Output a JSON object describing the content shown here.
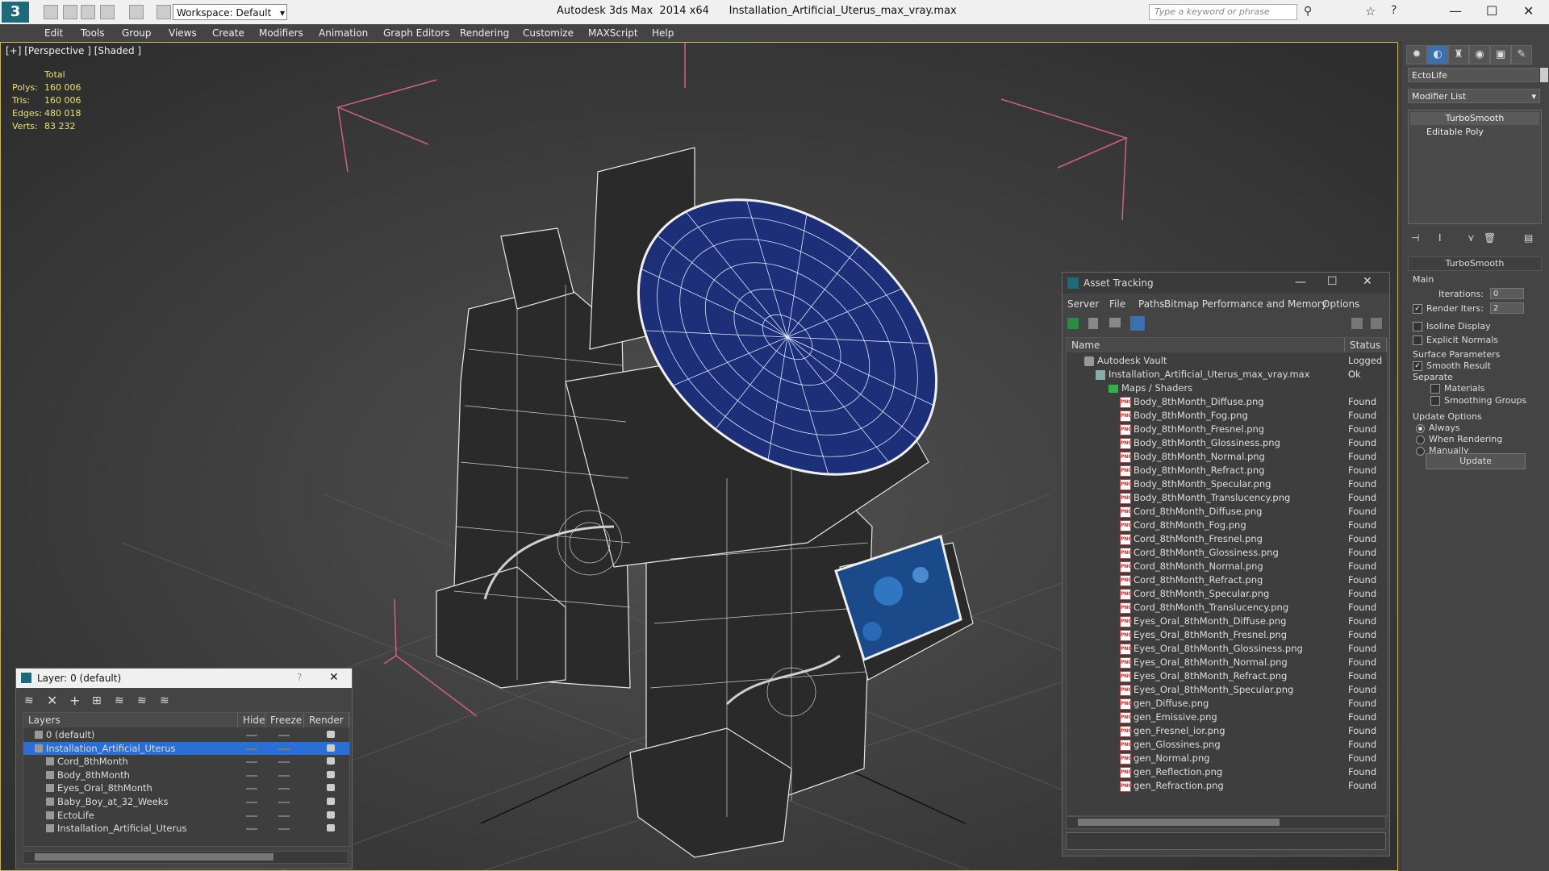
{
  "titlebar": {
    "logo": "3",
    "workspace": "Workspace: Default",
    "app_title": "Autodesk 3ds Max  2014 x64      Installation_Artificial_Uterus_max_vray.max",
    "search_placeholder": "Type a keyword or phrase"
  },
  "menu": [
    "Edit",
    "Tools",
    "Group",
    "Views",
    "Create",
    "Modifiers",
    "Animation",
    "Graph Editors",
    "Rendering",
    "Customize",
    "MAXScript",
    "Help"
  ],
  "viewport": {
    "label": "[+] [Perspective ] [Shaded ]",
    "stats_header": "Total",
    "stats": [
      {
        "k": "Polys:",
        "v": "160 006"
      },
      {
        "k": "Tris:",
        "v": "160 006"
      },
      {
        "k": "Edges:",
        "v": "480 018"
      },
      {
        "k": "Verts:",
        "v": "83 232"
      }
    ]
  },
  "command_panel": {
    "object_name": "EctoLife",
    "modifier_list": "Modifier List",
    "stack": [
      "TurboSmooth",
      "Editable Poly"
    ],
    "rollout_title": "TurboSmooth",
    "main_label": "Main",
    "iterations_label": "Iterations:",
    "iterations_value": "0",
    "render_iters_label": "Render Iters:",
    "render_iters_value": "2",
    "isoline": "Isoline Display",
    "explicit_normals": "Explicit Normals",
    "surface_params": "Surface Parameters",
    "smooth_result": "Smooth Result",
    "separate": "Separate",
    "materials": "Materials",
    "smoothing_groups": "Smoothing Groups",
    "update_options": "Update Options",
    "always": "Always",
    "when_rendering": "When Rendering",
    "manually": "Manually",
    "update_button": "Update"
  },
  "asset_tracking": {
    "title": "Asset Tracking",
    "menu": [
      "Server",
      "File",
      "Paths",
      "Bitmap Performance and Memory",
      "Options"
    ],
    "col_name": "Name",
    "col_status": "Status",
    "vault": {
      "name": "Autodesk Vault",
      "status": "Logged O"
    },
    "file": {
      "name": "Installation_Artificial_Uterus_max_vray.max",
      "status": "Ok"
    },
    "folder": {
      "name": "Maps / Shaders",
      "status": ""
    },
    "maps": [
      "Body_8thMonth_Diffuse.png",
      "Body_8thMonth_Fog.png",
      "Body_8thMonth_Fresnel.png",
      "Body_8thMonth_Glossiness.png",
      "Body_8thMonth_Normal.png",
      "Body_8thMonth_Refract.png",
      "Body_8thMonth_Specular.png",
      "Body_8thMonth_Translucency.png",
      "Cord_8thMonth_Diffuse.png",
      "Cord_8thMonth_Fog.png",
      "Cord_8thMonth_Fresnel.png",
      "Cord_8thMonth_Glossiness.png",
      "Cord_8thMonth_Normal.png",
      "Cord_8thMonth_Refract.png",
      "Cord_8thMonth_Specular.png",
      "Cord_8thMonth_Translucency.png",
      "Eyes_Oral_8thMonth_Diffuse.png",
      "Eyes_Oral_8thMonth_Fresnel.png",
      "Eyes_Oral_8thMonth_Glossiness.png",
      "Eyes_Oral_8thMonth_Normal.png",
      "Eyes_Oral_8thMonth_Refract.png",
      "Eyes_Oral_8thMonth_Specular.png",
      "gen_Diffuse.png",
      "gen_Emissive.png",
      "gen_Fresnel_ior.png",
      "gen_Glossines.png",
      "gen_Normal.png",
      "gen_Reflection.png",
      "gen_Refraction.png"
    ],
    "map_status": "Found",
    "png_tag": "PNG"
  },
  "layer_window": {
    "title": "Layer: 0 (default)",
    "help": "?",
    "col_layers": "Layers",
    "col_hide": "Hide",
    "col_freeze": "Freeze",
    "col_render": "Render",
    "rows": [
      {
        "name": "0 (default)",
        "indent": 0
      },
      {
        "name": "Installation_Artificial_Uterus",
        "indent": 0
      },
      {
        "name": "Cord_8thMonth",
        "indent": 1
      },
      {
        "name": "Body_8thMonth",
        "indent": 1
      },
      {
        "name": "Eyes_Oral_8thMonth",
        "indent": 1
      },
      {
        "name": "Baby_Boy_at_32_Weeks",
        "indent": 1
      },
      {
        "name": "EctoLife",
        "indent": 1
      },
      {
        "name": "Installation_Artificial_Uterus",
        "indent": 1
      }
    ]
  },
  "colors": {
    "accent_blue": "#2a6fd6",
    "dome_blue": "#1c2f78",
    "stats_yellow": "#e8e070",
    "found_status": "#dddddd"
  }
}
